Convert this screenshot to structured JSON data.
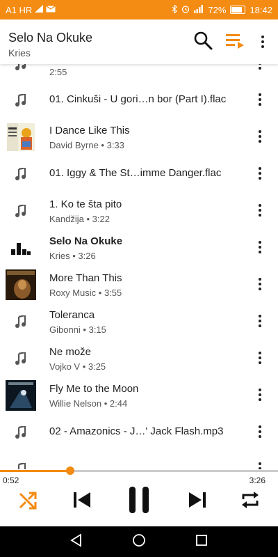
{
  "status_bar": {
    "carrier": "A1 HR",
    "battery": "72%",
    "time": "18:42"
  },
  "header": {
    "title": "Selo Na Okuke",
    "subtitle": "Kries",
    "icons": [
      "search-icon",
      "play-queue-icon",
      "more-vert-icon"
    ]
  },
  "tracks": [
    {
      "title": "",
      "subtitle": "2:55",
      "thumb": "music-note-icon"
    },
    {
      "title": "01. Cinkuši - U gori…n bor (Part I).flac",
      "subtitle": "",
      "thumb": "music-note-icon"
    },
    {
      "title": "I Dance Like This",
      "subtitle": "David Byrne  •  3:33",
      "thumb": "album-art"
    },
    {
      "title": "01. Iggy & The St…imme Danger.flac",
      "subtitle": "",
      "thumb": "music-note-icon"
    },
    {
      "title": "1. Ko te šta pito",
      "subtitle": "Kandžija  •  3:22",
      "thumb": "music-note-icon"
    },
    {
      "title": "Selo Na Okuke",
      "subtitle": "Kries  •  3:26",
      "thumb": "now-playing-equalizer-icon",
      "playing": true
    },
    {
      "title": "More Than This",
      "subtitle": "Roxy Music  •  3:55",
      "thumb": "album-art"
    },
    {
      "title": "Toleranca",
      "subtitle": "Gibonni  •  3:15",
      "thumb": "music-note-icon"
    },
    {
      "title": "Ne može",
      "subtitle": "Vojko V  •  3:25",
      "thumb": "music-note-icon"
    },
    {
      "title": "Fly Me to the Moon",
      "subtitle": "Willie Nelson  •  2:44",
      "thumb": "album-art"
    },
    {
      "title": "02 - Amazonics - J…' Jack Flash.mp3",
      "subtitle": "",
      "thumb": "music-note-icon"
    },
    {
      "title": "",
      "subtitle": "",
      "thumb": "music-note-icon"
    }
  ],
  "player": {
    "current_time": "0:52",
    "total_time": "3:26",
    "progress": 0.252,
    "controls": [
      "shuffle-icon",
      "skip-previous-icon",
      "pause-icon",
      "skip-next-icon",
      "repeat-icon"
    ]
  },
  "colors": {
    "accent": "#f48b12",
    "text": "#222222",
    "secondary": "#555555"
  }
}
